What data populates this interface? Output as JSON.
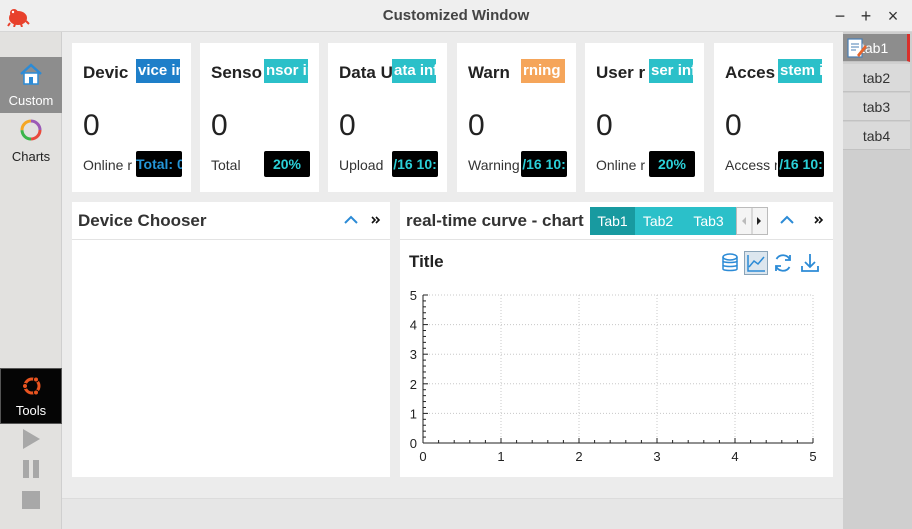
{
  "window": {
    "title": "Customized Window",
    "minimize_icon": "−",
    "maximize_icon": "+",
    "close_icon": "×"
  },
  "left_nav": [
    {
      "label": "Custom",
      "icon": "home-icon"
    },
    {
      "label": "Charts",
      "icon": "ring-chart-icon"
    },
    {
      "label": "Tools",
      "icon": "ubuntu-icon"
    }
  ],
  "cards": [
    {
      "title": "Devic",
      "badge": "vice in",
      "badge_color": "#1e7fc9",
      "value": "0",
      "label": "Online r",
      "status": "Total: 0",
      "status_color": "#2596d8"
    },
    {
      "title": "Senso",
      "badge": "nsor in",
      "badge_color": "#2bc0c9",
      "value": "0",
      "label": "Total",
      "status": "20%",
      "status_color": "#2bd0d8"
    },
    {
      "title": "Data U",
      "badge": "ata inf",
      "badge_color": "#2bc0c9",
      "value": "0",
      "label": "Upload",
      "status": "/16 10:",
      "status_color": "#2bd0d8"
    },
    {
      "title": "Warn",
      "badge": "rning i",
      "badge_color": "#f5a55a",
      "value": "0",
      "label": "Warning",
      "status": "/16 10:",
      "status_color": "#2bd0d8"
    },
    {
      "title": "User r",
      "badge": "ser inf",
      "badge_color": "#2bc0c9",
      "value": "0",
      "label": "Online r",
      "status": "20%",
      "status_color": "#2bd0d8"
    },
    {
      "title": "Acces",
      "badge": "stem in",
      "badge_color": "#2bc0c9",
      "value": "0",
      "label": "Access r",
      "status": "/16 10:",
      "status_color": "#2bd0d8"
    }
  ],
  "device_chooser": {
    "title": "Device Chooser"
  },
  "chart_panel": {
    "title": "real-time curve - chart",
    "tabs": [
      "Tab1",
      "Tab2",
      "Tab3"
    ],
    "chart_title": "Title"
  },
  "right_tabs": [
    "tab1",
    "tab2",
    "tab3",
    "tab4"
  ],
  "chart_data": {
    "type": "line",
    "title": "Title",
    "xlabel": "",
    "ylabel": "",
    "xlim": [
      0,
      5
    ],
    "ylim": [
      0,
      5
    ],
    "xticks": [
      "0",
      "1",
      "2",
      "3",
      "4",
      "5"
    ],
    "yticks": [
      "0",
      "1",
      "2",
      "3",
      "4",
      "5"
    ],
    "grid": true,
    "series": []
  }
}
